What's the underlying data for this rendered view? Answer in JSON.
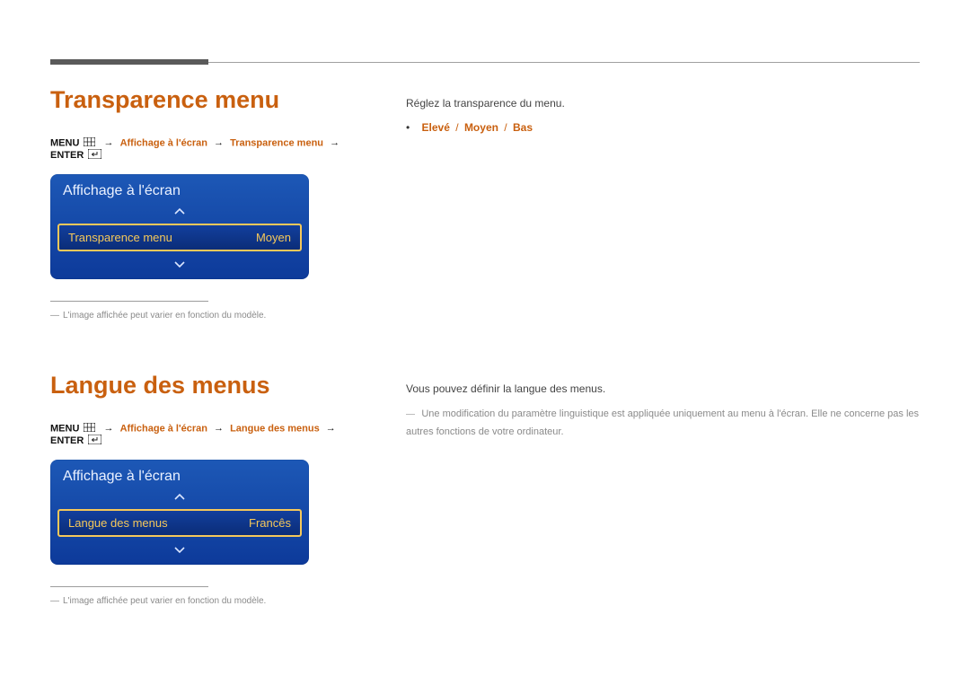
{
  "sections": {
    "transparency": {
      "title": "Transparence menu",
      "path": {
        "menu_label": "MENU",
        "p1": "Affichage à l'écran",
        "p2": "Transparence menu",
        "enter_label": "ENTER"
      },
      "osd": {
        "header": "Affichage à l'écran",
        "item_label": "Transparence menu",
        "item_value": "Moyen"
      },
      "footnote": "L'image affichée peut varier en fonction du modèle."
    },
    "language": {
      "title": "Langue des menus",
      "path": {
        "menu_label": "MENU",
        "p1": "Affichage à l'écran",
        "p2": "Langue des menus",
        "enter_label": "ENTER"
      },
      "osd": {
        "header": "Affichage à l'écran",
        "item_label": "Langue des menus",
        "item_value": "Francês"
      },
      "footnote": "L'image affichée peut varier en fonction du modèle."
    }
  },
  "right": {
    "transparency": {
      "desc": "Réglez la transparence du menu.",
      "options": [
        "Elevé",
        "Moyen",
        "Bas"
      ]
    },
    "language": {
      "desc": "Vous pouvez définir la langue des menus.",
      "note": "Une modification du paramètre linguistique est appliquée uniquement au menu à l'écran. Elle ne concerne pas les autres fonctions de votre ordinateur."
    }
  }
}
